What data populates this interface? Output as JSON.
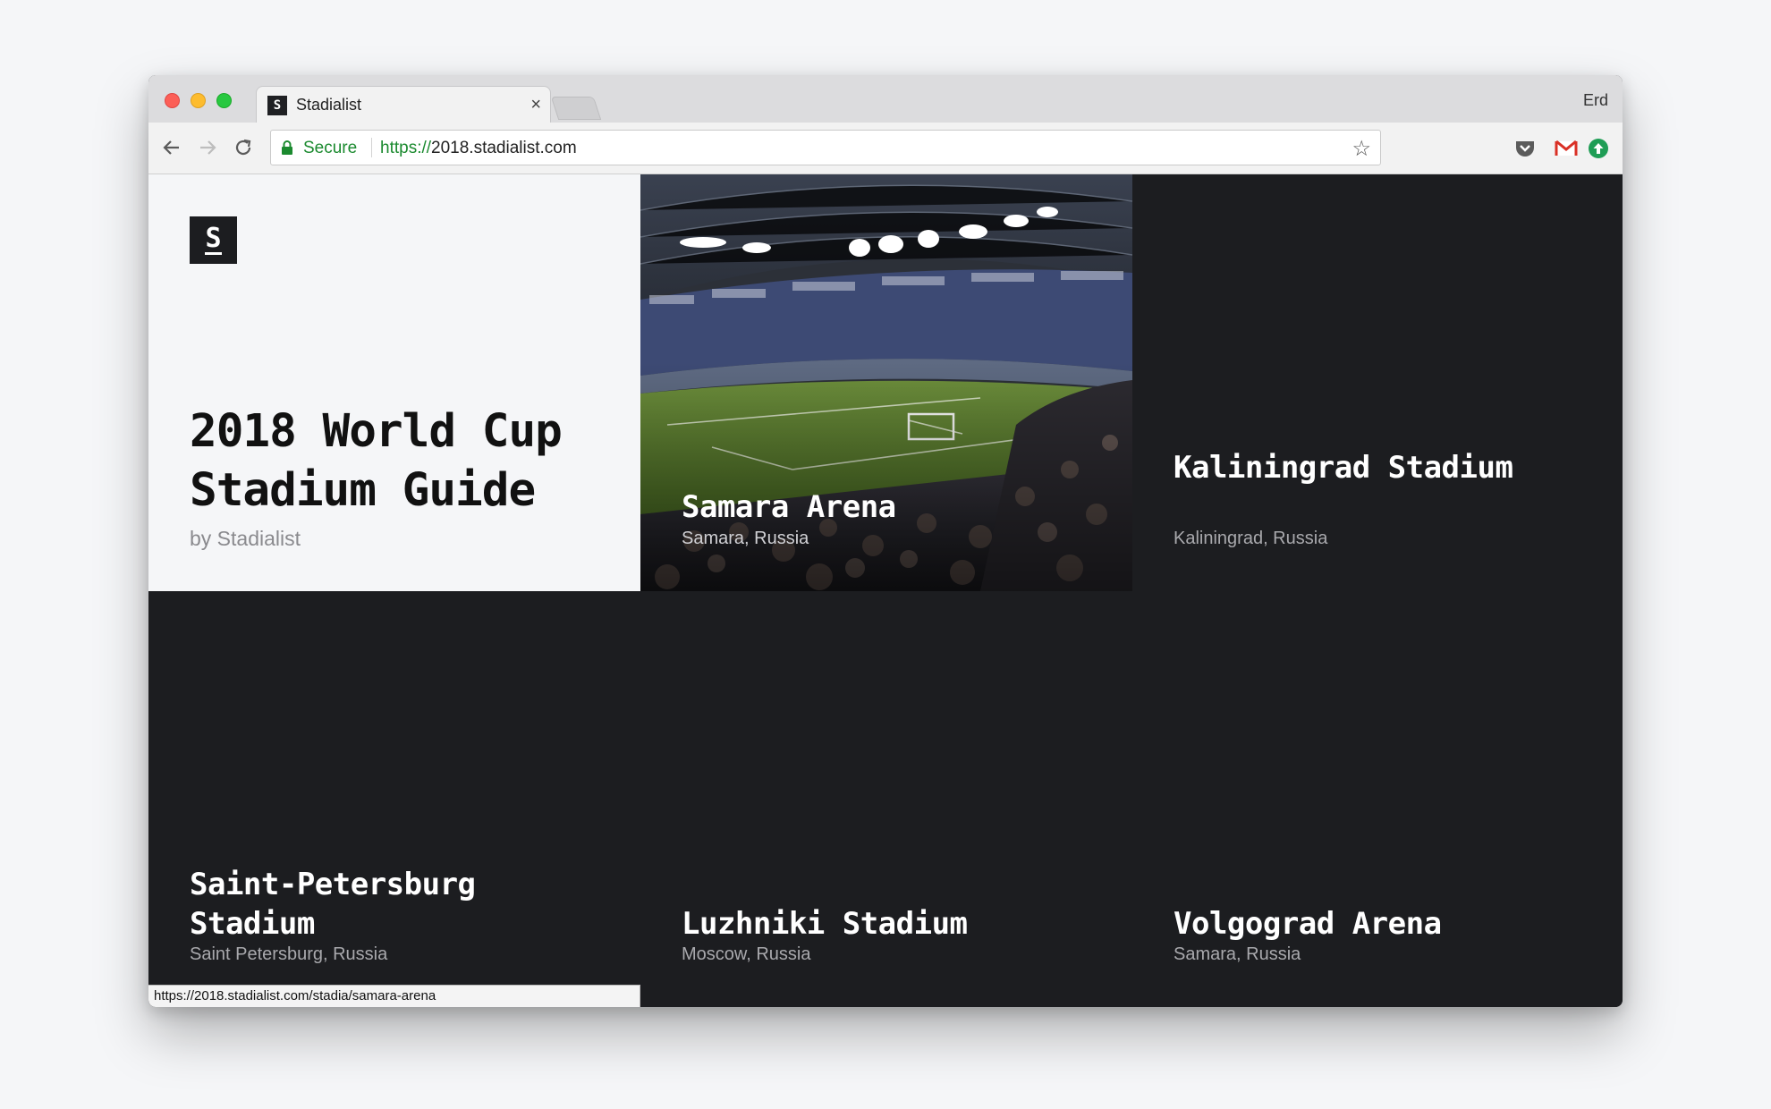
{
  "browser": {
    "tab_title": "Stadialist",
    "tab_favicon_letter": "S",
    "tab_close": "×",
    "profile_name": "Erd",
    "secure_label": "Secure",
    "url_scheme": "https://",
    "url_host": "2018.stadialist.com",
    "status_url": "https://2018.stadialist.com/stadia/samara-arena"
  },
  "hero": {
    "logo_letter": "S",
    "title": "2018 World Cup Stadium Guide",
    "byline": "by Stadialist"
  },
  "stadiums": [
    {
      "name": "Samara Arena",
      "location": "Samara, Russia"
    },
    {
      "name": "Kaliningrad Stadium",
      "location": "Kaliningrad, Russia"
    },
    {
      "name": "Saint-Petersburg Stadium",
      "location": "Saint Petersburg, Russia"
    },
    {
      "name": "Luzhniki Stadium",
      "location": "Moscow, Russia"
    },
    {
      "name": "Volgograd Arena",
      "location": "Samara, Russia"
    }
  ],
  "colors": {
    "page_dark": "#1c1d20",
    "hero_light": "#f5f6f8",
    "secure_green": "#1b8a2f"
  }
}
